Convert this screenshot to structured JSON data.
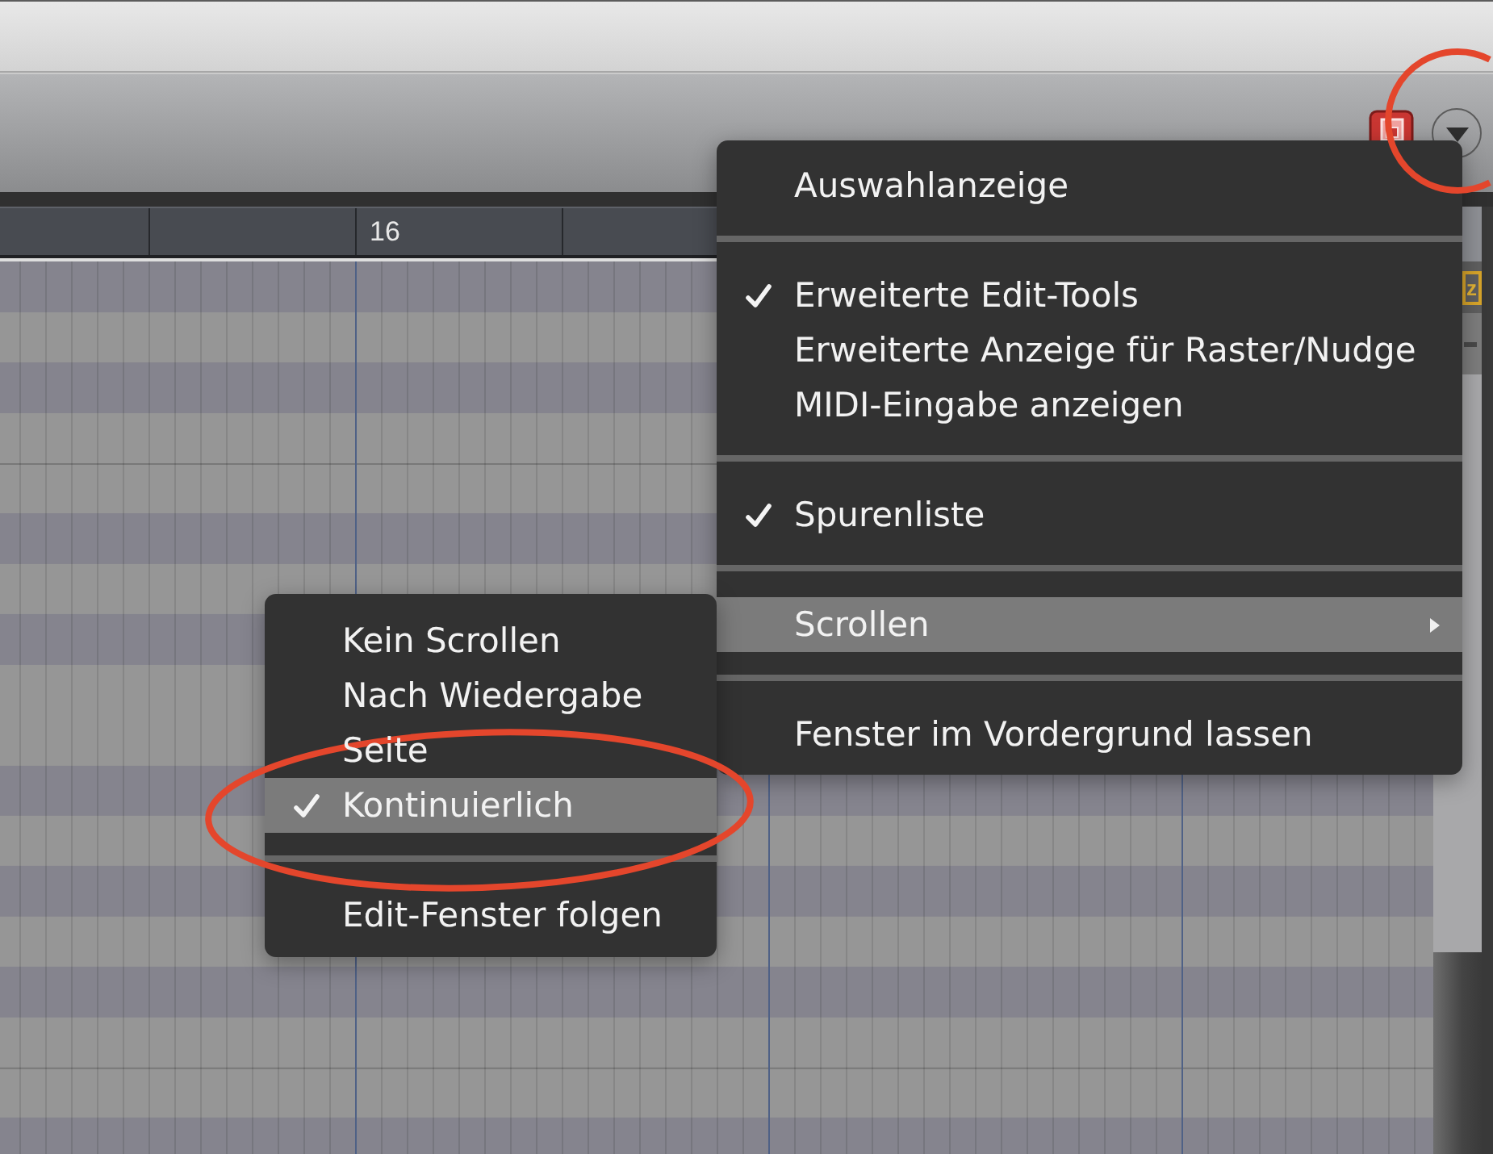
{
  "ruler": {
    "marks": [
      {
        "label": "16"
      }
    ]
  },
  "side_tag": {
    "label": "z"
  },
  "menu": {
    "items": [
      {
        "kind": "item",
        "label": "Auswahlanzeige",
        "checked": false,
        "selected": false
      },
      {
        "kind": "separator"
      },
      {
        "kind": "item",
        "label": "Erweiterte Edit-Tools",
        "checked": true,
        "selected": false
      },
      {
        "kind": "item",
        "label": "Erweiterte Anzeige für Raster/Nudge",
        "checked": false,
        "selected": false
      },
      {
        "kind": "item",
        "label": "MIDI-Eingabe anzeigen",
        "checked": false,
        "selected": false
      },
      {
        "kind": "separator"
      },
      {
        "kind": "item",
        "label": "Spurenliste",
        "checked": true,
        "selected": false
      },
      {
        "kind": "separator"
      },
      {
        "kind": "submenu",
        "label": "Scrollen",
        "checked": false,
        "selected": true
      },
      {
        "kind": "separator"
      },
      {
        "kind": "item",
        "label": "Fenster im Vordergrund lassen",
        "checked": false,
        "selected": false
      }
    ]
  },
  "submenu": {
    "items": [
      {
        "kind": "item",
        "label": "Kein Scrollen",
        "checked": false,
        "selected": false
      },
      {
        "kind": "item",
        "label": "Nach Wiedergabe",
        "checked": false,
        "selected": false
      },
      {
        "kind": "item",
        "label": "Seite",
        "checked": false,
        "selected": false
      },
      {
        "kind": "item",
        "label": "Kontinuierlich",
        "checked": true,
        "selected": true
      },
      {
        "kind": "separator"
      },
      {
        "kind": "item",
        "label": "Edit-Fenster folgen",
        "checked": false,
        "selected": false
      }
    ]
  },
  "annotations": [
    {
      "kind": "ellipse"
    },
    {
      "kind": "circle"
    }
  ]
}
